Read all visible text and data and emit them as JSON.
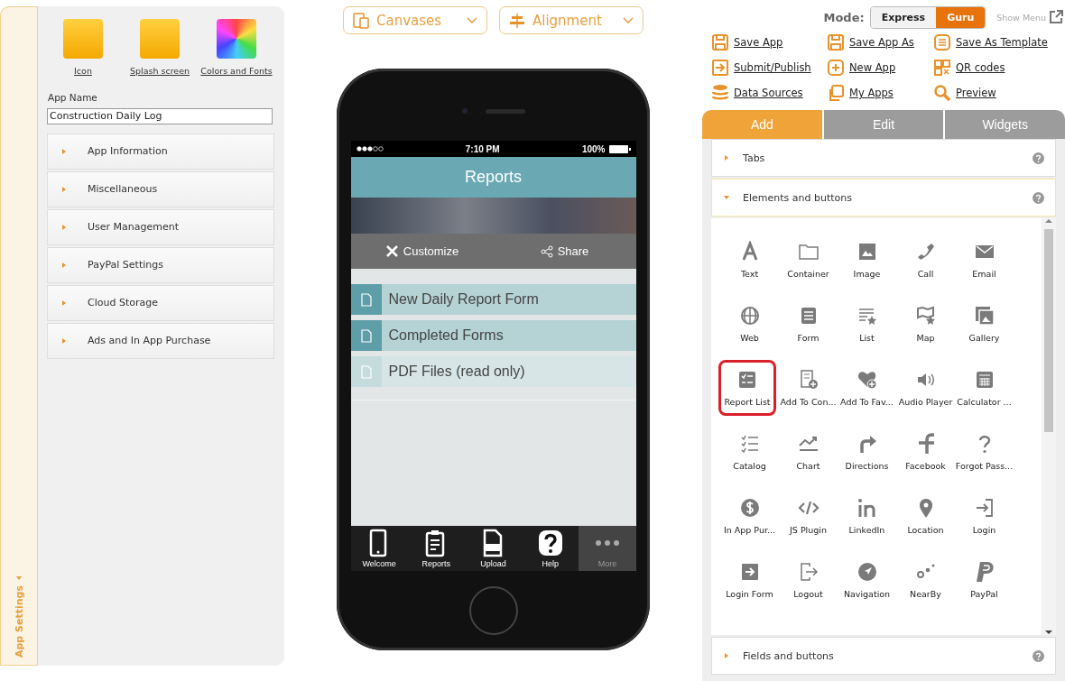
{
  "left_panel": {
    "side_tab": "App Settings",
    "assets": [
      {
        "label": "Icon"
      },
      {
        "label": "Splash screen"
      },
      {
        "label": "Colors and Fonts"
      }
    ],
    "app_name": {
      "label": "App Name",
      "value": "Construction Daily Log"
    },
    "sections": [
      {
        "label": "App Information",
        "expanded": false
      },
      {
        "label": "Miscellaneous",
        "expanded": false
      },
      {
        "label": "User Management",
        "expanded": false
      },
      {
        "label": "PayPal Settings",
        "expanded": false
      },
      {
        "label": "Cloud Storage",
        "expanded": false
      },
      {
        "label": "Ads and In App Purchase",
        "expanded": false
      }
    ]
  },
  "toolbar": {
    "dropdowns": [
      {
        "label": "Canvases"
      },
      {
        "label": "Alignment"
      }
    ]
  },
  "phone": {
    "status": {
      "time": "7:10 PM",
      "battery": "100%"
    },
    "title": "Reports",
    "actions": [
      {
        "label": "Customize"
      },
      {
        "label": "Share"
      }
    ],
    "list": [
      {
        "label": "New Daily Report Form",
        "dimmed": false
      },
      {
        "label": "Completed Forms",
        "dimmed": false
      },
      {
        "label": "PDF Files (read only)",
        "dimmed": true
      }
    ],
    "tab_bar": [
      {
        "label": "Welcome",
        "selected": false
      },
      {
        "label": "Reports",
        "selected": false
      },
      {
        "label": "Upload",
        "selected": false
      },
      {
        "label": "Help",
        "selected": false
      },
      {
        "label": "More",
        "selected": true
      }
    ]
  },
  "right_panel": {
    "mode": {
      "label": "Mode:",
      "options": [
        {
          "label": "Express",
          "selected": false
        },
        {
          "label": "Guru",
          "selected": true
        }
      ]
    },
    "show_menu": "Show Menu",
    "links": [
      {
        "label": "Save App"
      },
      {
        "label": "Save App As"
      },
      {
        "label": "Save As Template"
      },
      {
        "label": "Submit/Publish"
      },
      {
        "label": "New App"
      },
      {
        "label": "QR codes"
      },
      {
        "label": "Data Sources"
      },
      {
        "label": "My Apps"
      },
      {
        "label": "Preview"
      }
    ],
    "tabs": [
      {
        "label": "Add",
        "selected": true
      },
      {
        "label": "Edit",
        "selected": false
      },
      {
        "label": "Widgets",
        "selected": false
      }
    ],
    "sections": [
      {
        "label": "Tabs",
        "expanded": false
      },
      {
        "label": "Elements and buttons",
        "expanded": true,
        "elements": [
          {
            "label": "Text",
            "highlighted": false
          },
          {
            "label": "Container",
            "highlighted": false
          },
          {
            "label": "Image",
            "highlighted": false
          },
          {
            "label": "Call",
            "highlighted": false
          },
          {
            "label": "Email",
            "highlighted": false
          },
          {
            "label": "Web",
            "highlighted": false
          },
          {
            "label": "Form",
            "highlighted": false
          },
          {
            "label": "List",
            "highlighted": false
          },
          {
            "label": "Map",
            "highlighted": false
          },
          {
            "label": "Gallery",
            "highlighted": false
          },
          {
            "label": "Report List",
            "highlighted": true
          },
          {
            "label": "Add To Con...",
            "highlighted": false
          },
          {
            "label": "Add To Fav...",
            "highlighted": false
          },
          {
            "label": "Audio Player",
            "highlighted": false
          },
          {
            "label": "Calculator ...",
            "highlighted": false
          },
          {
            "label": "Catalog",
            "highlighted": false
          },
          {
            "label": "Chart",
            "highlighted": false
          },
          {
            "label": "Directions",
            "highlighted": false
          },
          {
            "label": "Facebook",
            "highlighted": false
          },
          {
            "label": "Forgot Pass...",
            "highlighted": false
          },
          {
            "label": "In App Pur...",
            "highlighted": false
          },
          {
            "label": "JS Plugin",
            "highlighted": false
          },
          {
            "label": "LinkedIn",
            "highlighted": false
          },
          {
            "label": "Location",
            "highlighted": false
          },
          {
            "label": "Login",
            "highlighted": false
          },
          {
            "label": "Login Form",
            "highlighted": false
          },
          {
            "label": "Logout",
            "highlighted": false
          },
          {
            "label": "Navigation",
            "highlighted": false
          },
          {
            "label": "NearBy",
            "highlighted": false
          },
          {
            "label": "PayPal",
            "highlighted": false
          }
        ]
      },
      {
        "label": "Fields and buttons",
        "expanded": false
      }
    ]
  }
}
